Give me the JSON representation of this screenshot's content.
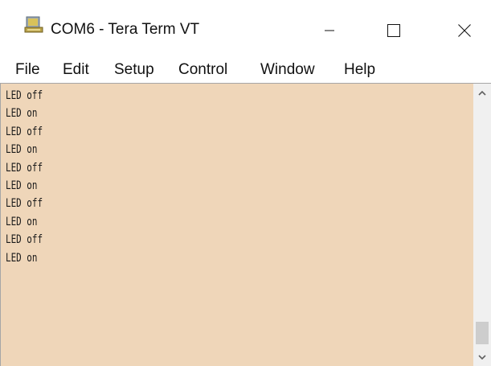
{
  "window": {
    "title": "COM6 - Tera Term VT",
    "icon": "tera-term-app-icon"
  },
  "menu": {
    "items": [
      {
        "label": "File"
      },
      {
        "label": "Edit"
      },
      {
        "label": "Setup"
      },
      {
        "label": "Control"
      },
      {
        "label": "Window"
      },
      {
        "label": "Help"
      }
    ]
  },
  "terminal": {
    "background_color": "#efd6b9",
    "text_color": "#1a1a1a",
    "lines": [
      "LED off",
      "LED on",
      "LED off",
      "LED on",
      "LED off",
      "LED on",
      "LED off",
      "LED on",
      "LED off",
      "LED on"
    ]
  },
  "controls": {
    "minimize_icon": "minimize-icon",
    "maximize_icon": "maximize-icon",
    "close_icon": "close-icon",
    "scroll_up_icon": "chevron-up-icon",
    "scroll_down_icon": "chevron-down-icon"
  }
}
